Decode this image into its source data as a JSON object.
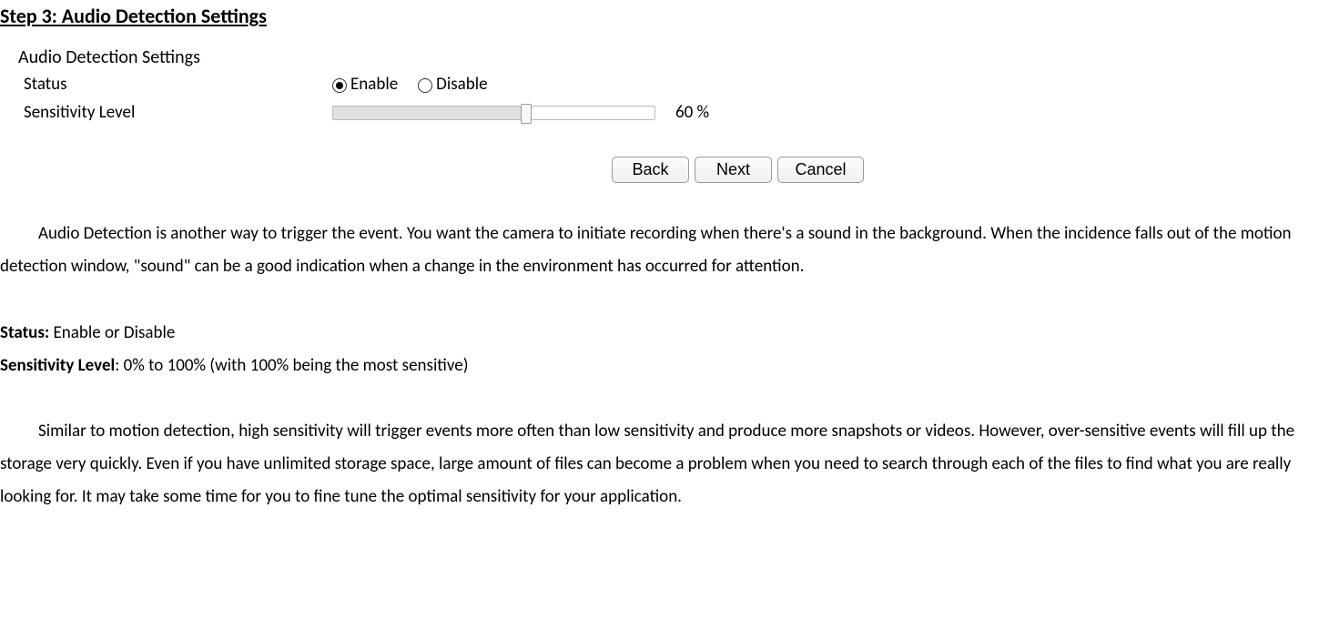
{
  "step_title": "Step 3: Audio Detection Settings",
  "panel": {
    "title": "Audio Detection Settings",
    "status_label": "Status",
    "enable_label": "Enable",
    "disable_label": "Disable",
    "sensitivity_label": "Sensitivity Level",
    "sensitivity_value": "60 %"
  },
  "buttons": {
    "back": "Back",
    "next": "Next",
    "cancel": "Cancel"
  },
  "para1": "Audio Detection is another way to trigger the event. You want the camera to initiate recording when there's a sound in the background. When the incidence falls out of the motion detection window, \"sound\" can be a good indication when a change in the environment has occurred for attention.",
  "defs": {
    "status_bold": "Status:",
    "status_text": " Enable or Disable",
    "sens_bold": "Sensitivity Level",
    "sens_text": ": 0% to 100% (with 100% being the most sensitive)"
  },
  "para2": "Similar to motion detection, high sensitivity will trigger events more often than low sensitivity and produce more snapshots or videos. However, over-sensitive events will fill up the storage very quickly. Even if you have unlimited storage space, large amount of files can become a problem when you need to search through each of the files to find what you are really looking for. It may take some time for you to fine tune the optimal sensitivity for your application."
}
